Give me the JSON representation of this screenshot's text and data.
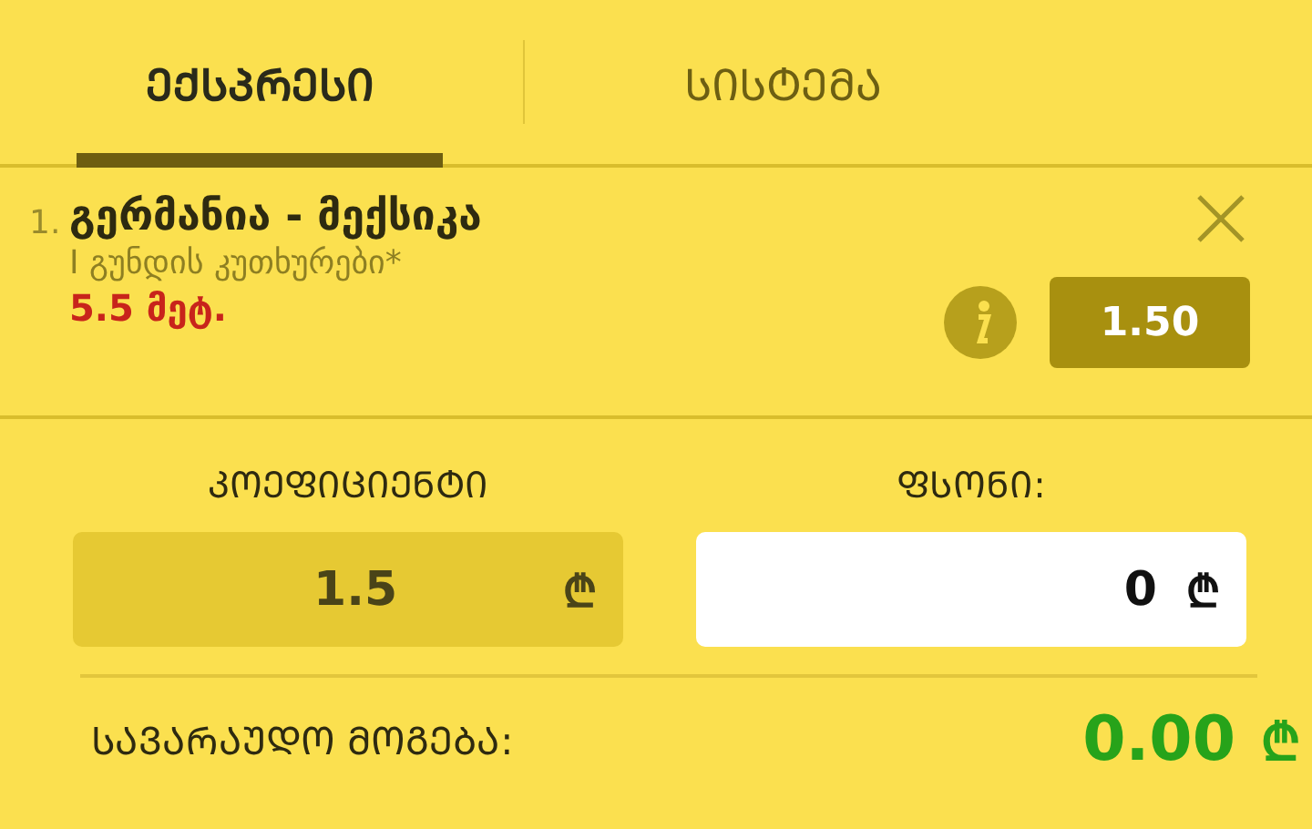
{
  "tabs": [
    {
      "label": "ᲔᲥᲡᲞᲠᲔᲡᲘ",
      "selected": true
    },
    {
      "label": "ᲡᲘᲡᲢᲔᲛᲐ",
      "selected": false
    }
  ],
  "bet": {
    "number": "1.",
    "match": "გერმანია - მექსიკა",
    "market": "I გუნდის კუთხურები*",
    "selection": "5.5 მეტ.",
    "odds": "1.50"
  },
  "coefficient": {
    "label": "ᲙᲝᲔᲤᲘᲪᲘᲔᲜᲢᲘ",
    "value": "1.5",
    "currency": "₾"
  },
  "stake": {
    "label": "ᲤᲡᲝᲜᲘ:",
    "value": "0",
    "currency": "₾"
  },
  "profit": {
    "label": "ᲡᲐᲕᲐᲠᲐᲣᲓᲝ ᲛᲝᲒᲔᲑᲐ:",
    "value": "0.00",
    "currency": "₾"
  }
}
